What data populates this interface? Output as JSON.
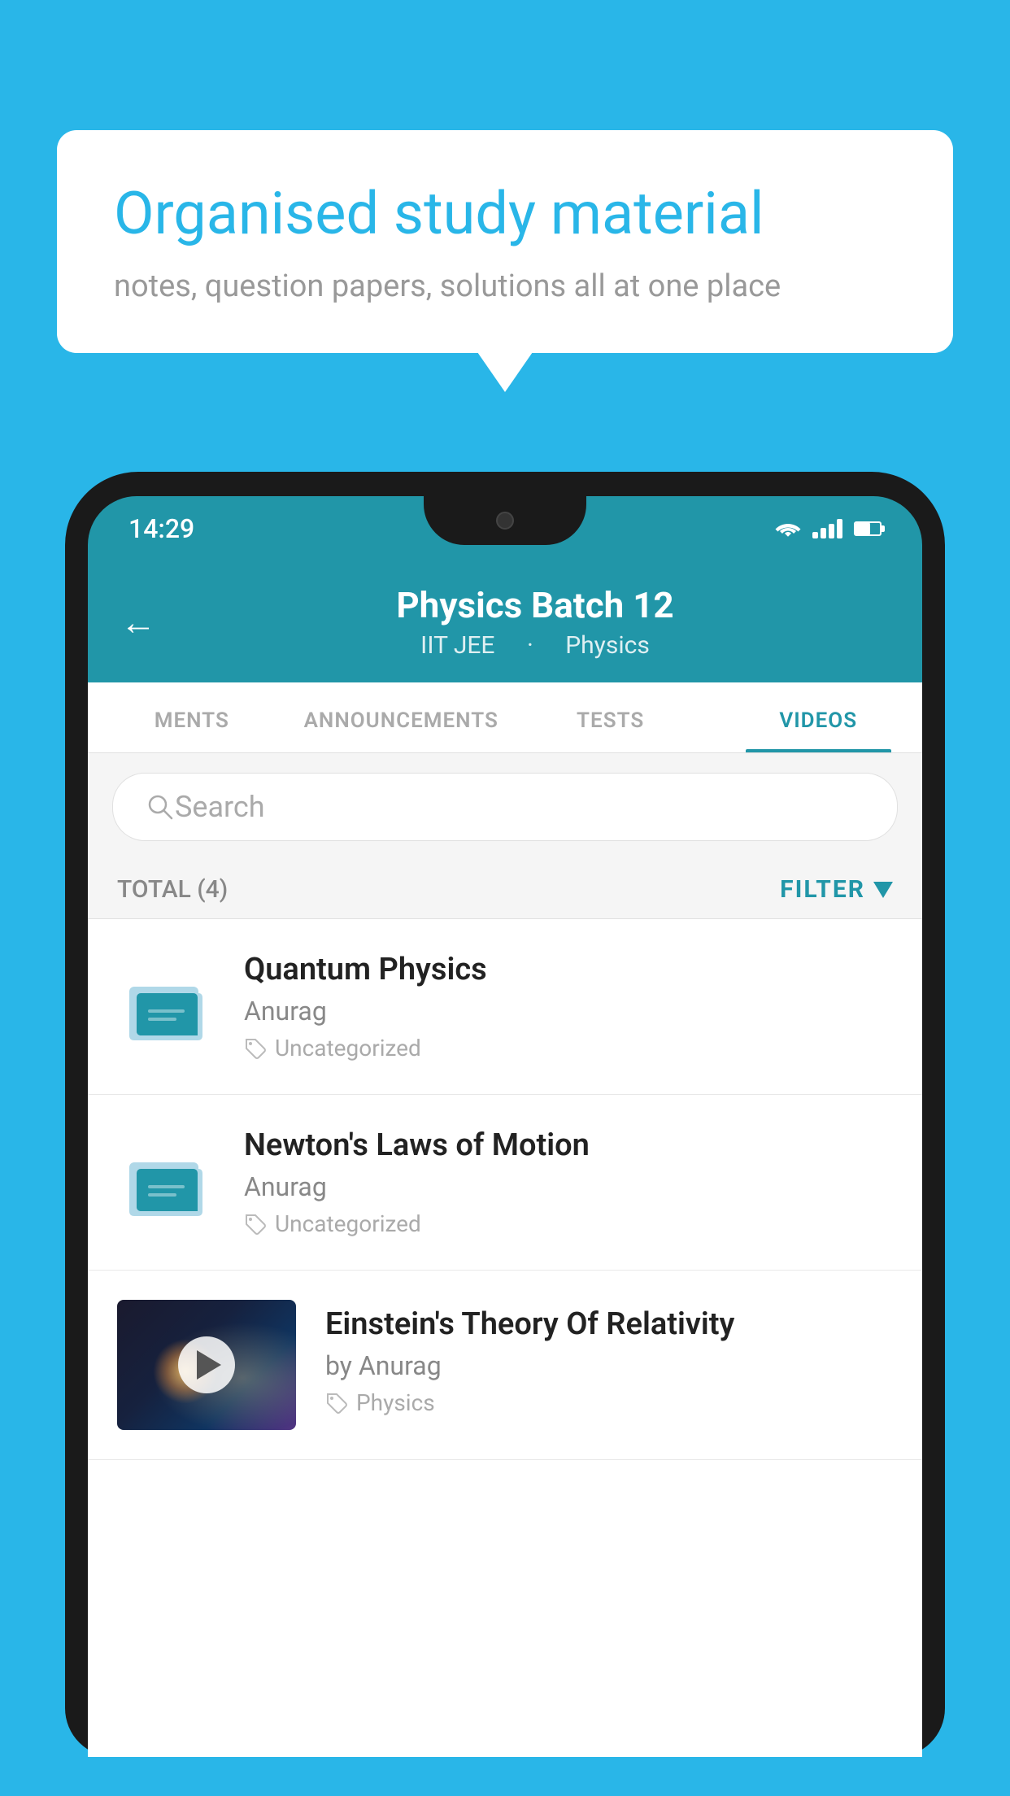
{
  "background_color": "#29b6e8",
  "speech_bubble": {
    "title": "Organised study material",
    "subtitle": "notes, question papers, solutions all at one place"
  },
  "phone": {
    "status_bar": {
      "time": "14:29"
    },
    "header": {
      "back_label": "←",
      "title": "Physics Batch 12",
      "subtitle_parts": [
        "IIT JEE",
        "Physics"
      ]
    },
    "tabs": [
      {
        "label": "MENTS",
        "active": false
      },
      {
        "label": "ANNOUNCEMENTS",
        "active": false
      },
      {
        "label": "TESTS",
        "active": false
      },
      {
        "label": "VIDEOS",
        "active": true
      }
    ],
    "search": {
      "placeholder": "Search"
    },
    "filter_row": {
      "total_label": "TOTAL (4)",
      "filter_label": "FILTER"
    },
    "video_items": [
      {
        "id": "quantum",
        "title": "Quantum Physics",
        "author": "Anurag",
        "tag": "Uncategorized",
        "has_thumbnail": false
      },
      {
        "id": "newton",
        "title": "Newton's Laws of Motion",
        "author": "Anurag",
        "tag": "Uncategorized",
        "has_thumbnail": false
      },
      {
        "id": "einstein",
        "title": "Einstein's Theory Of Relativity",
        "author": "by Anurag",
        "tag": "Physics",
        "has_thumbnail": true
      }
    ]
  }
}
